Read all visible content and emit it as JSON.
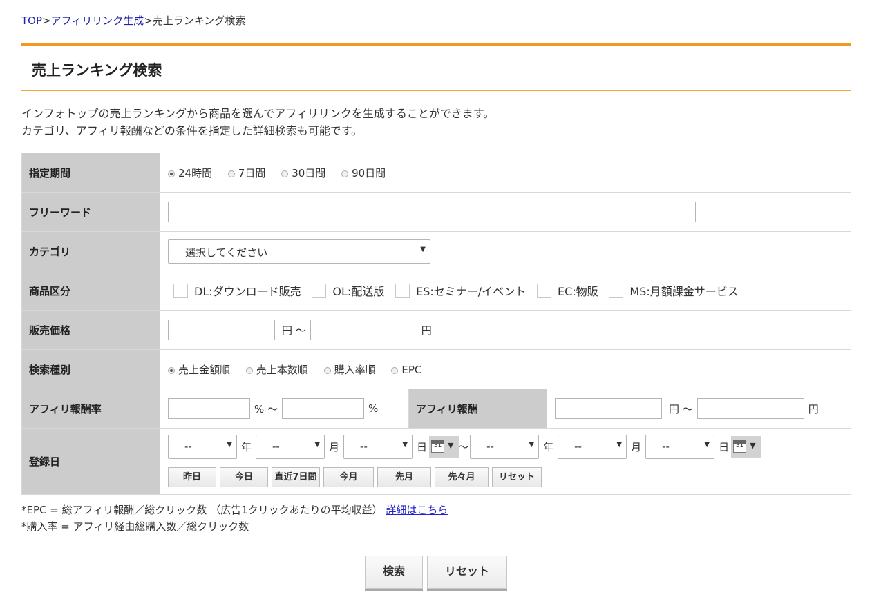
{
  "breadcrumb": {
    "top": "TOP",
    "sep1": ">",
    "link": "アフィリリンク生成",
    "sep2": ">",
    "current": "売上ランキング検索"
  },
  "page_title": "売上ランキング検索",
  "description": {
    "line1": "インフォトップの売上ランキングから商品を選んでアフィリリンクを生成することができます。",
    "line2": "カテゴリ、アフィリ報酬などの条件を指定した詳細検索も可能です。"
  },
  "form": {
    "period": {
      "label": "指定期間",
      "options": [
        "24時間",
        "7日間",
        "30日間",
        "90日間"
      ],
      "selected_index": 0
    },
    "freeword": {
      "label": "フリーワード",
      "value": ""
    },
    "category": {
      "label": "カテゴリ",
      "selected": "選択してください"
    },
    "product_type": {
      "label": "商品区分",
      "options": [
        "DL:ダウンロード販売",
        "OL:配送版",
        "ES:セミナー/イベント",
        "EC:物販",
        "MS:月額課金サービス"
      ]
    },
    "price": {
      "label": "販売価格",
      "unit1": "円 〜",
      "unit2": "円"
    },
    "search_type": {
      "label": "検索種別",
      "options": [
        "売上金額順",
        "売上本数順",
        "購入率順",
        "EPC"
      ],
      "selected_index": 0
    },
    "affiliate_rate": {
      "label": "アフィリ報酬率",
      "unit1": "% 〜",
      "unit2": "%"
    },
    "affiliate_reward": {
      "label": "アフィリ報酬",
      "unit1": "円 〜",
      "unit2": "円"
    },
    "registration_date": {
      "label": "登録日",
      "empty_value": "--",
      "year": "年",
      "month": "月",
      "day": "日",
      "range_sep": "〜",
      "calendar_day": "31",
      "quick_buttons": [
        "昨日",
        "今日",
        "直近7日間",
        "今月",
        "先月",
        "先々月",
        "リセット"
      ]
    }
  },
  "notes": {
    "epc": "*EPC = 総アフィリ報酬／総クリック数 （広告1クリックあたりの平均収益）",
    "epc_link": "詳細はこちら",
    "rate": "*購入率 = アフィリ経由総購入数／総クリック数"
  },
  "buttons": {
    "search": "検索",
    "reset": "リセット"
  }
}
